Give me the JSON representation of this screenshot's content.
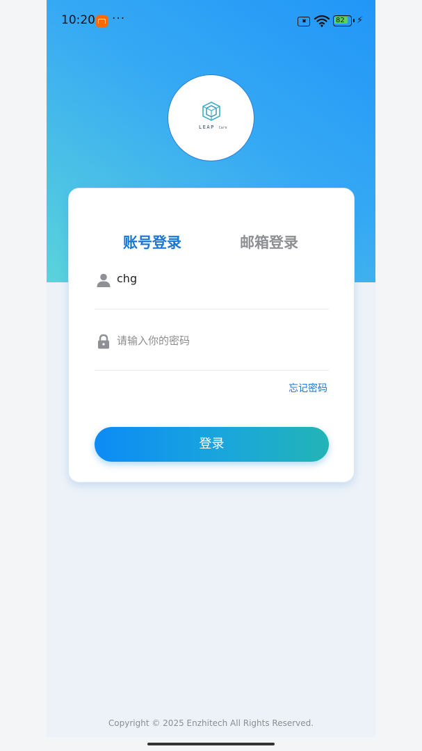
{
  "status_bar": {
    "time": "10:20",
    "dots": "···",
    "battery": "82",
    "icons": [
      "mi-app-icon",
      "no-sim-icon",
      "wifi-icon",
      "battery-icon",
      "charging-icon"
    ]
  },
  "logo": {
    "brand": "LEAP",
    "sub": "Care"
  },
  "tabs": [
    {
      "label": "账号登录",
      "active": true
    },
    {
      "label": "邮箱登录",
      "active": false
    }
  ],
  "form": {
    "username_value": "chg",
    "password_placeholder": "请输入你的密码",
    "forgot_label": "忘记密码",
    "login_label": "登录"
  },
  "footer": {
    "copyright": "Copyright © 2025 Enzhitech All Rights Reserved."
  },
  "colors": {
    "accent": "#1b77d6",
    "hero_start": "#2196f7",
    "hero_end": "#5ad3db",
    "button_start": "#0c8bf5",
    "button_end": "#22b4b6"
  }
}
